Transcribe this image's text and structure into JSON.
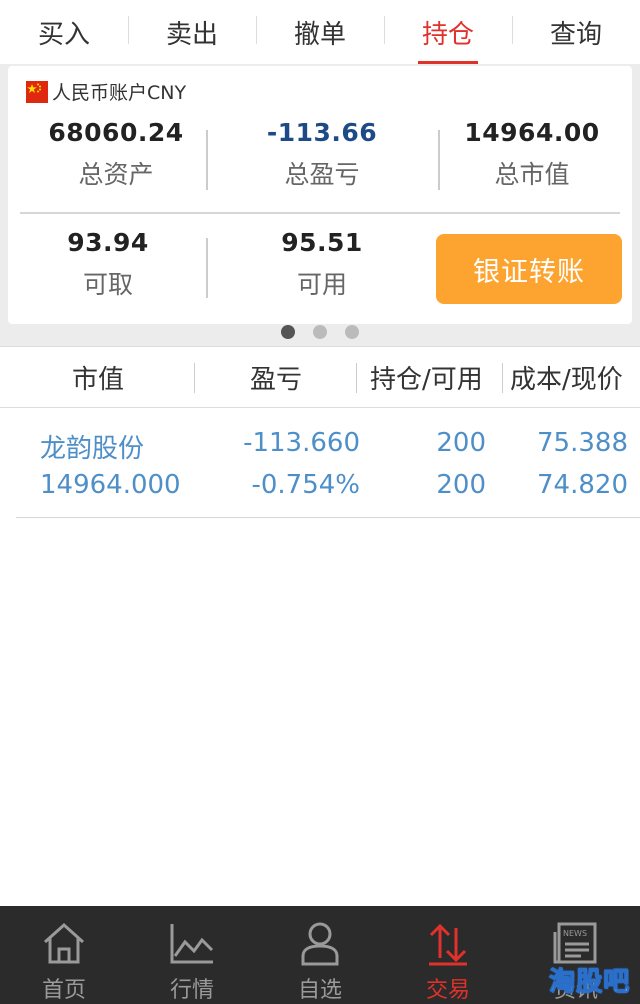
{
  "top_tabs": [
    {
      "label": "买入",
      "active": false
    },
    {
      "label": "卖出",
      "active": false
    },
    {
      "label": "撤单",
      "active": false
    },
    {
      "label": "持仓",
      "active": true
    },
    {
      "label": "查询",
      "active": false
    }
  ],
  "account": {
    "title": "人民币账户CNY",
    "flag_icon": "china-flag-icon",
    "total_assets": {
      "value": "68060.24",
      "label": "总资产"
    },
    "total_pnl": {
      "value": "-113.66",
      "label": "总盈亏"
    },
    "total_market_value": {
      "value": "14964.00",
      "label": "总市值"
    },
    "withdrawable": {
      "value": "93.94",
      "label": "可取"
    },
    "available": {
      "value": "95.51",
      "label": "可用"
    },
    "transfer_button": "银证转账",
    "page_dots": {
      "count": 3,
      "active_index": 0
    }
  },
  "table": {
    "headers": [
      "市值",
      "盈亏",
      "持仓/可用",
      "成本/现价"
    ],
    "rows": [
      {
        "name": "龙韵股份",
        "market_value": "14964.000",
        "pnl": "-113.660",
        "pnl_pct": "-0.754%",
        "position": "200",
        "available": "200",
        "cost": "75.388",
        "price": "74.820"
      }
    ]
  },
  "bottom_nav": [
    {
      "label": "首页",
      "icon": "home-icon",
      "active": false
    },
    {
      "label": "行情",
      "icon": "chart-line-icon",
      "active": false
    },
    {
      "label": "自选",
      "icon": "user-icon",
      "active": false
    },
    {
      "label": "交易",
      "icon": "trade-arrows-icon",
      "active": true
    },
    {
      "label": "资讯",
      "icon": "news-icon",
      "active": false
    }
  ],
  "watermark": "淘股吧",
  "colors": {
    "accent_red": "#e0312b",
    "transfer_orange": "#fca42f",
    "holding_blue": "#4f8fc8",
    "pnl_dark_blue": "#1e4a86",
    "nav_bg": "#2b2b2b"
  }
}
